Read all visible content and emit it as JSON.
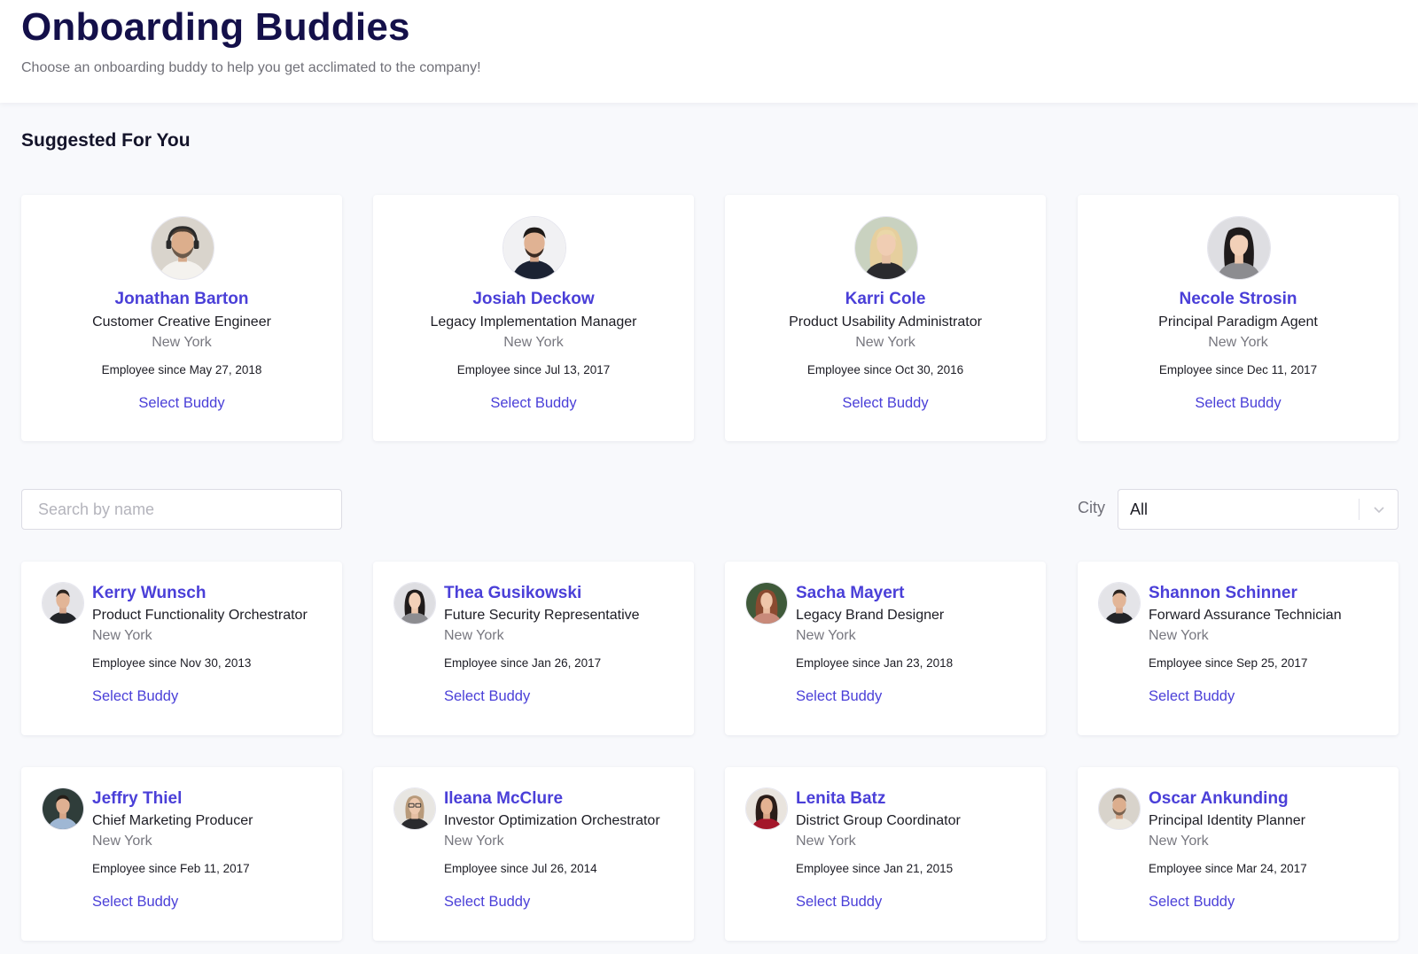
{
  "header": {
    "title": "Onboarding Buddies",
    "subtitle": "Choose an onboarding buddy to help you get acclimated to the company!"
  },
  "suggested": {
    "title": "Suggested For You",
    "cards": [
      {
        "name": "Jonathan Barton",
        "role": "Customer Creative Engineer",
        "city": "New York",
        "since": "Employee since May 27, 2018",
        "action": "Select Buddy",
        "avatar": "avatar-man-beard-headphones"
      },
      {
        "name": "Josiah Deckow",
        "role": "Legacy Implementation Manager",
        "city": "New York",
        "since": "Employee since Jul 13, 2017",
        "action": "Select Buddy",
        "avatar": "avatar-man-dark-sweater"
      },
      {
        "name": "Karri Cole",
        "role": "Product Usability Administrator",
        "city": "New York",
        "since": "Employee since Oct 30, 2016",
        "action": "Select Buddy",
        "avatar": "avatar-woman-blonde"
      },
      {
        "name": "Necole Strosin",
        "role": "Principal Paradigm Agent",
        "city": "New York",
        "since": "Employee since Dec 11, 2017",
        "action": "Select Buddy",
        "avatar": "avatar-woman-dark-hair"
      }
    ]
  },
  "filters": {
    "search_placeholder": "Search by name",
    "city_label": "City",
    "city_value": "All"
  },
  "buddies": [
    {
      "name": "Kerry Wunsch",
      "role": "Product Functionality Orchestrator",
      "city": "New York",
      "since": "Employee since Nov 30, 2013",
      "action": "Select Buddy",
      "avatar": "avatar-man-dark-shirt"
    },
    {
      "name": "Thea Gusikowski",
      "role": "Future Security Representative",
      "city": "New York",
      "since": "Employee since Jan 26, 2017",
      "action": "Select Buddy",
      "avatar": "avatar-woman-dark-hair"
    },
    {
      "name": "Sacha Mayert",
      "role": "Legacy Brand Designer",
      "city": "New York",
      "since": "Employee since Jan 23, 2018",
      "action": "Select Buddy",
      "avatar": "avatar-woman-red-hair"
    },
    {
      "name": "Shannon Schinner",
      "role": "Forward Assurance Technician",
      "city": "New York",
      "since": "Employee since Sep 25, 2017",
      "action": "Select Buddy",
      "avatar": "avatar-man-dark-shirt"
    },
    {
      "name": "Jeffry Thiel",
      "role": "Chief Marketing Producer",
      "city": "New York",
      "since": "Employee since Feb 11, 2017",
      "action": "Select Buddy",
      "avatar": "avatar-man-blue-shirt"
    },
    {
      "name": "Ileana McClure",
      "role": "Investor Optimization Orchestrator",
      "city": "New York",
      "since": "Employee since Jul 26, 2014",
      "action": "Select Buddy",
      "avatar": "avatar-woman-glasses"
    },
    {
      "name": "Lenita Batz",
      "role": "District Group Coordinator",
      "city": "New York",
      "since": "Employee since Jan 21, 2015",
      "action": "Select Buddy",
      "avatar": "avatar-woman-red-top"
    },
    {
      "name": "Oscar Ankunding",
      "role": "Principal Identity Planner",
      "city": "New York",
      "since": "Employee since Mar 24, 2017",
      "action": "Select Buddy",
      "avatar": "avatar-man-beard-light"
    }
  ],
  "colors": {
    "accent": "#4a3fd8",
    "title": "#14104a",
    "muted": "#77777f",
    "background": "#f8f9fc"
  }
}
